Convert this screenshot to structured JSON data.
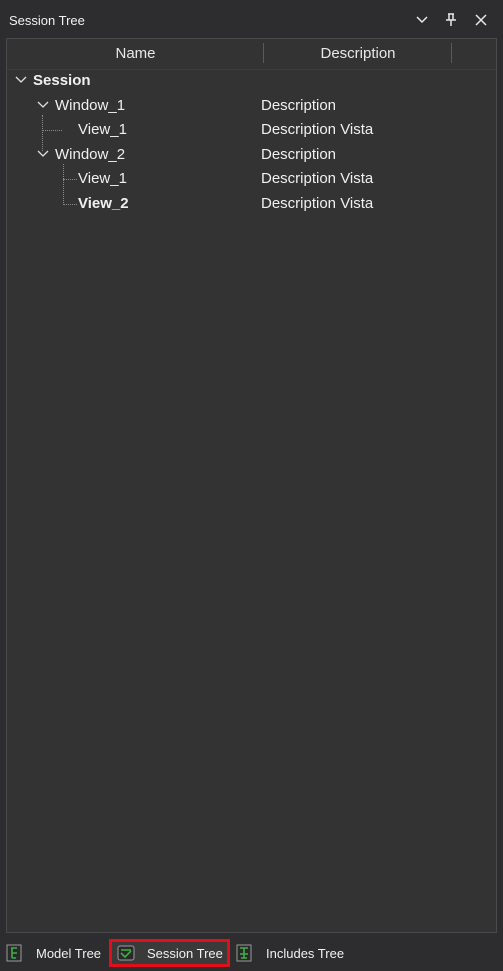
{
  "window": {
    "title": "Session Tree",
    "dropdown_icon": "chevron-down-icon",
    "pin_icon": "pin-icon",
    "close_icon": "close-icon"
  },
  "columns": {
    "name": "Name",
    "description": "Description"
  },
  "tree": {
    "root": {
      "label": "Session"
    },
    "window1": {
      "label": "Window_1",
      "description": "Description"
    },
    "window1_view1": {
      "label": "View_1",
      "description": "Description Vista"
    },
    "window2": {
      "label": "Window_2",
      "description": "Description"
    },
    "window2_view1": {
      "label": "View_1",
      "description": "Description Vista"
    },
    "window2_view2": {
      "label": "View_2",
      "description": "Description Vista"
    }
  },
  "bottom_tabs": [
    {
      "label": "Model Tree",
      "icon": "model-tree-icon"
    },
    {
      "label": "Session Tree",
      "icon": "session-tree-icon"
    },
    {
      "label": "Includes Tree",
      "icon": "includes-tree-icon"
    }
  ],
  "colors": {
    "background": "#2d2d30",
    "panel": "#333333",
    "active_tab_outline": "#e0101a",
    "icon_green": "#3fae49"
  }
}
